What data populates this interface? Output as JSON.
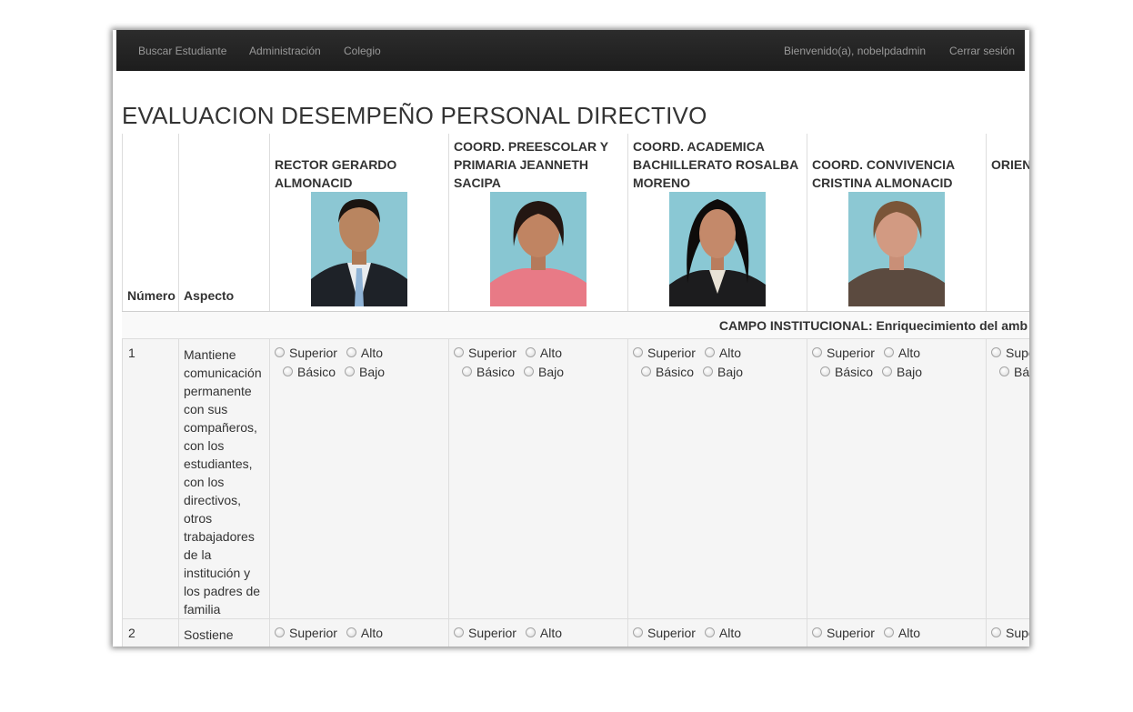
{
  "navbar": {
    "left_items": [
      "Buscar Estudiante",
      "Administración",
      "Colegio"
    ],
    "welcome": "Bienvenido(a), nobelpdadmin",
    "logout": "Cerrar sesión"
  },
  "page": {
    "title": "EVALUACION DESEMPEÑO PERSONAL DIRECTIVO"
  },
  "table": {
    "col_numero": "Número",
    "col_aspecto": "Aspecto",
    "people": [
      "RECTOR GERARDO ALMONACID",
      "COORD. PREESCOLAR Y PRIMARIA JEANNETH SACIPA",
      "COORD. ACADEMICA BACHILLERATO ROSALBA MORENO",
      "COORD. CONVIVENCIA CRISTINA ALMONACID",
      "ORIENTACION DIANA"
    ],
    "section": "CAMPO INSTITUCIONAL: Enriquecimiento del amb",
    "options": [
      "Superior",
      "Alto",
      "Básico",
      "Bajo"
    ],
    "rows": [
      {
        "num": "1",
        "aspect": "Mantiene comunicación permanente con sus compañeros, con los estudiantes, con los directivos, otros trabajadores de la institución y los padres de familia"
      },
      {
        "num": "2",
        "aspect": "Sostiene relaciones de"
      }
    ]
  }
}
